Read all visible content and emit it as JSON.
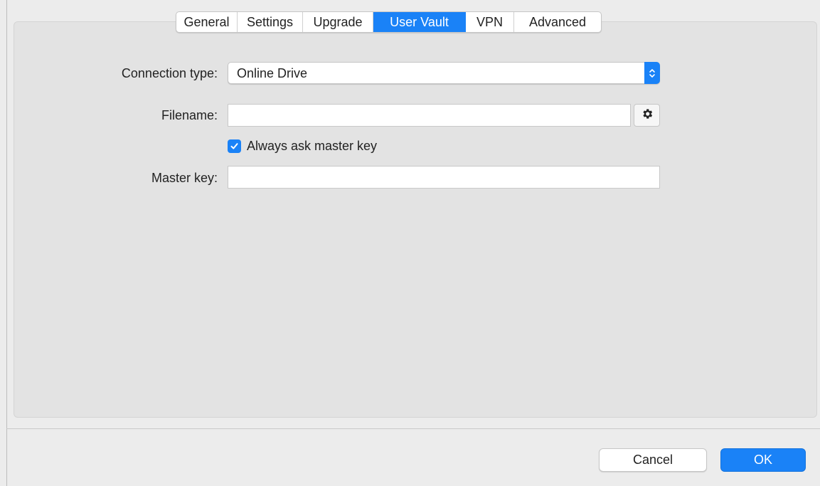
{
  "tabs": [
    {
      "label": "General",
      "active": false
    },
    {
      "label": "Settings",
      "active": false
    },
    {
      "label": "Upgrade",
      "active": false
    },
    {
      "label": "User Vault",
      "active": true
    },
    {
      "label": "VPN",
      "active": false
    },
    {
      "label": "Advanced",
      "active": false
    }
  ],
  "form": {
    "connection_type_label": "Connection type:",
    "connection_type_value": "Online Drive",
    "filename_label": "Filename:",
    "filename_value": "",
    "always_ask_label": "Always ask master key",
    "always_ask_checked": true,
    "master_key_label": "Master key:",
    "master_key_value": ""
  },
  "buttons": {
    "cancel_label": "Cancel",
    "ok_label": "OK"
  },
  "colors": {
    "accent": "#1a82f7",
    "panel_bg": "#e3e3e3",
    "window_bg": "#ececec"
  },
  "icons": {
    "filename_browse": "gear-icon",
    "select_arrows": "chevron-updown-icon",
    "checkbox": "checkmark-icon"
  }
}
